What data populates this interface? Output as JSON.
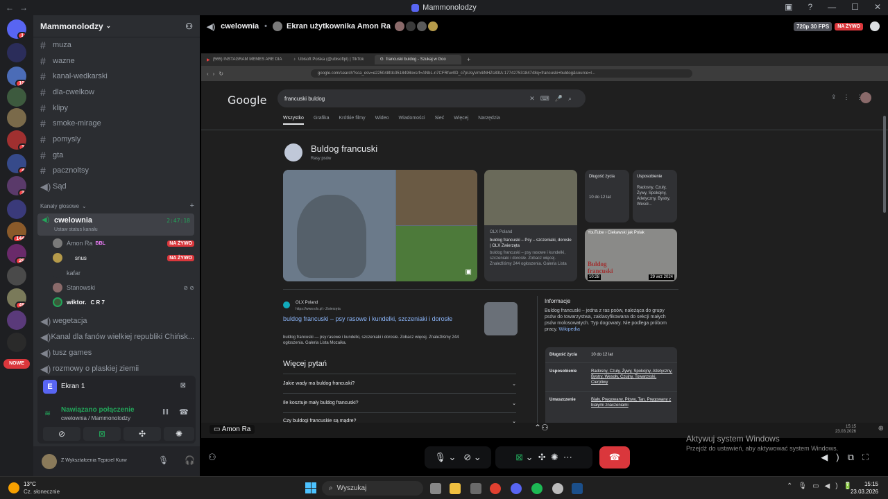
{
  "titlebar": {
    "title": "Mammonolodzy"
  },
  "guild": {
    "name": "Mammonolodzy"
  },
  "text_channels": [
    "muza",
    "wazne",
    "kanal-wedkarski",
    "dla-cwelkow",
    "klipy",
    "smoke-mirage",
    "pomysly",
    "gta",
    "pacznoltsy",
    "Sąd"
  ],
  "voice_category": "Kanały głosowe",
  "voice_channel": {
    "name": "cwelownia",
    "time": "2:47:18",
    "status": "Ustaw status kanału"
  },
  "voice_users": [
    {
      "name": "Amon Ra",
      "tag": "BBL",
      "live": "NA ŻYWO"
    },
    {
      "name": "snus",
      "live": "NA ŻYWO"
    },
    {
      "name": "kafar"
    },
    {
      "name": "Stanowski"
    },
    {
      "name": "wiktor.",
      "tag": "C R 7"
    }
  ],
  "more_channels": [
    "wegetacja",
    "Kanal dla fanów wielkiej republiki Chińsk...",
    "tusz games",
    "rozmowy o plaskiej ziemii"
  ],
  "new_badge": "NOWE",
  "server_badges": [
    "1",
    "10",
    "1",
    "4",
    "2",
    "144",
    "26",
    "49"
  ],
  "ekran": {
    "label": "Ekran 1"
  },
  "connection": {
    "status": "Nawiązano połączenie",
    "where": "cwelownia / Mammonolodzy"
  },
  "user": {
    "status": "Z Wykształcenia Tępiciel Kurw"
  },
  "main_header": {
    "channel": "cwelownia",
    "screen": "Ekran użytkownika Amon Ra",
    "quality": "720p 30 FPS",
    "live": "NA ŻYWO"
  },
  "browser": {
    "tabs": [
      "(565) INSTAGRAM MEMES ARE DIA",
      "Ubisoft Polska (@ubisoftpl) | TikTok",
      "francuski buldog - Szukaj w Goo"
    ],
    "url": "google.com/search?sca_esv=e225048fdc3518498oxsrf=ANbL-n7CFRfuv0D_c7pUsyVm4iNHZs83tA:17742753184748q=francuski+buldog&source=l..."
  },
  "google": {
    "logo": "Google",
    "query": "francuski buldog",
    "tabs": [
      "Wszystko",
      "Grafika",
      "Krótkie filmy",
      "Wideo",
      "Wiadomości",
      "Sieć",
      "Więcej",
      "Narzędzia"
    ],
    "kp_title": "Buldog francuski",
    "kp_sub": "Rasy psów",
    "lifespan_label": "Długość życia",
    "lifespan": "10 do 12 lat",
    "temper_label": "Usposobienie",
    "temper": "Radosny, Czuły, Żywy, Spokojny, Atletyczny, Bystry, Wesoł...",
    "olx_card": {
      "source": "OLX Poland",
      "title": "buldog francuski – Psy – szczeniaki, dorosłe | OLX Zwierzęta",
      "desc": "buldog francuski – psy rasowe i kundelki, szczeniaki i dorosłe. Zobacz więcej. Znaleźliśmy 244 ogłoszenia. Galeria Lista"
    },
    "yt_card": {
      "source": "YouTube › Ciekawski jak Polak",
      "duration": "10:28",
      "date": "29 wrz 2024",
      "overlay": "Buldog francuski"
    },
    "result": {
      "source": "OLX Poland",
      "url": "https://www.olx.pl › Zwierzęta",
      "title": "buldog francuski – psy rasowe i kundelki, szczeniaki i dorosłe",
      "snippet": "buldog francuski — psy rasowe i kundelki, szczeniaki i dorosłe. Zobacz więcej. Znaleźliśmy 244 ogłoszenia. Galeria Lista Mozaika."
    },
    "paa_title": "Więcej pytań",
    "paa": [
      "Jakie wady ma buldog francuski?",
      "Ile kosztuje mały buldog francuski?",
      "Czy buldogi francuskie są mądre?"
    ],
    "info_title": "Informacje",
    "info_text": "Buldog francuski – jedna z ras psów, należąca do grupy psów do towarzystwa, zaklasyfikowana do sekcji małych psów molosowatych. Typ dogowaty. Nie podlega próbom pracy.",
    "info_link": "Wikipedia",
    "facts": [
      {
        "k": "Długość życia",
        "v": "10 do 12 lat"
      },
      {
        "k": "Usposobienie",
        "v": "Radosny, Czuły, Żywy, Spokojny, Atletyczny, Bystry, Wesoły, Czujny, Towarzyski, Cierpliwy"
      },
      {
        "k": "Umaszczenie",
        "v": "Biały, Pręgowany, Płowy, Tan, Pręgowany z białymi znaczeniami"
      }
    ]
  },
  "inner_taskbar": {
    "label": "Amon Ra",
    "time": "15:15",
    "date": "23.03.2026"
  },
  "activate": {
    "title": "Aktywuj system Windows",
    "sub": "Przejdź do ustawień, aby aktywować system Windows."
  },
  "taskbar": {
    "temp": "13°C",
    "weather": "Cz. słonecznie",
    "search": "Wyszukaj",
    "time": "15:15",
    "date": "23.03.2026"
  }
}
